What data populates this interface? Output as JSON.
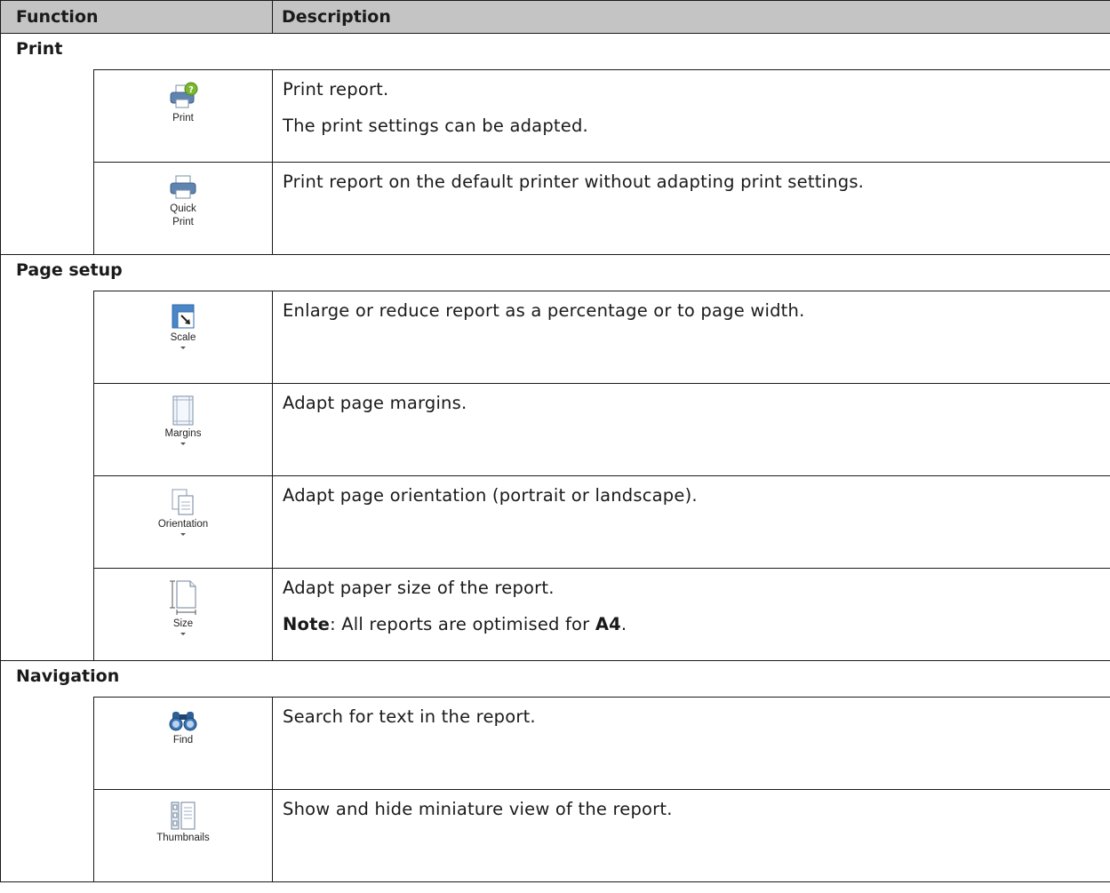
{
  "header": {
    "function": "Function",
    "description": "Description"
  },
  "groups": {
    "print": "Print",
    "page_setup": "Page setup",
    "navigation": "Navigation"
  },
  "rows": {
    "print": {
      "icon_label": "Print",
      "desc": "Print report.",
      "desc2": "The print settings can be adapted."
    },
    "quick_print": {
      "icon_label_1": "Quick",
      "icon_label_2": "Print",
      "desc": "Print report on the default printer without adapting print settings."
    },
    "scale": {
      "icon_label": "Scale",
      "desc": "Enlarge or reduce report as a percentage or to page width."
    },
    "margins": {
      "icon_label": "Margins",
      "desc": "Adapt page margins."
    },
    "orientation": {
      "icon_label": "Orientation",
      "desc": "Adapt page orientation (portrait or landscape)."
    },
    "size": {
      "icon_label": "Size",
      "desc": "Adapt paper size of the report.",
      "note_label": "Note",
      "note_text": ": All reports are optimised for ",
      "note_value": "A4",
      "note_end": "."
    },
    "find": {
      "icon_label": "Find",
      "desc": "Search for text in the report."
    },
    "thumbnails": {
      "icon_label": "Thumbnails",
      "desc": "Show and hide miniature view of the report."
    }
  },
  "icons": {
    "print": "printer-help-icon",
    "quick_print": "printer-icon",
    "scale": "scale-icon",
    "margins": "margins-icon",
    "orientation": "orientation-icon",
    "size": "paper-size-icon",
    "find": "binoculars-icon",
    "thumbnails": "thumbnails-icon"
  }
}
